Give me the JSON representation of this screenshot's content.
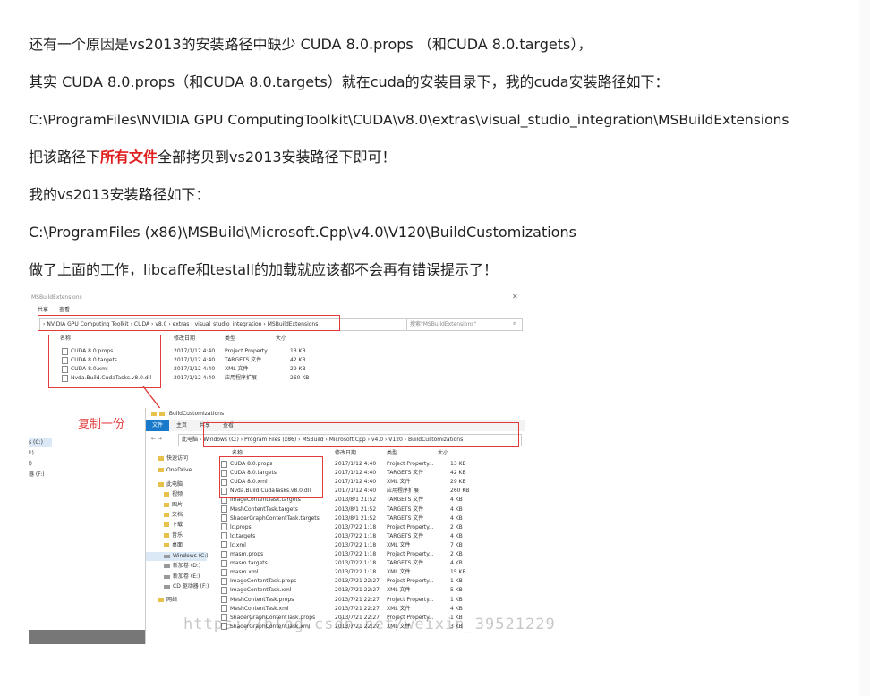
{
  "paragraphs": {
    "p1": "还有一个原因是vs2013的安装路径中缺少 CUDA 8.0.props （和CUDA 8.0.targets），",
    "p2": "其实 CUDA 8.0.props（和CUDA 8.0.targets）就在cuda的安装目录下，我的cuda安装路径如下：",
    "p3": "C:\\ProgramFiles\\NVIDIA GPU ComputingToolkit\\CUDA\\v8.0\\extras\\visual_studio_integration\\MSBuildExtensions",
    "p4_before": "把该路径下",
    "p4_highlight": "所有文件",
    "p4_after": "全部拷贝到vs2013安装路径下即可！",
    "p5": "我的vs2013安装路径如下：",
    "p6": "C:\\ProgramFiles (x86)\\MSBuild\\Microsoft.Cpp\\v4.0\\V120\\BuildCustomizations",
    "p7": "做了上面的工作，libcaffe和testall的加载就应该都不会再有错误提示了！"
  },
  "screenshot": {
    "win1": {
      "title": "MSBuildExtensions",
      "ribbon": [
        "共享",
        "查看"
      ],
      "path": [
        "NVIDIA GPU Computing Toolkit",
        "CUDA",
        "v8.0",
        "extras",
        "visual_studio_integration",
        "MSBuildExtensions"
      ],
      "search_placeholder": "搜索\"MSBuildExtensions\"",
      "headers": [
        "名称",
        "修改日期",
        "类型",
        "大小"
      ],
      "files": [
        {
          "name": "CUDA 8.0.props",
          "date": "2017/1/12 4:40",
          "type": "Project Property...",
          "size": "13 KB"
        },
        {
          "name": "CUDA 8.0.targets",
          "date": "2017/1/12 4:40",
          "type": "TARGETS 文件",
          "size": "42 KB"
        },
        {
          "name": "CUDA 8.0.xml",
          "date": "2017/1/12 4:40",
          "type": "XML 文件",
          "size": "29 KB"
        },
        {
          "name": "Nvda.Build.CudaTasks.v8.0.dll",
          "date": "2017/1/12 4:40",
          "type": "应用程序扩展",
          "size": "260 KB"
        }
      ]
    },
    "annotation": "复制一份",
    "left_strip": [
      "s (C:)",
      "k)",
      "l)",
      "器 (F:)"
    ],
    "win2": {
      "title": "BuildCustomizations",
      "ribbon": [
        "文件",
        "主页",
        "共享",
        "查看"
      ],
      "path": [
        "此电脑",
        "Windows (C:)",
        "Program Files (x86)",
        "MSBuild",
        "Microsoft.Cpp",
        "v4.0",
        "V120",
        "BuildCustomizations"
      ],
      "headers": [
        "名称",
        "修改日期",
        "类型",
        "大小"
      ],
      "nav": [
        {
          "label": "快速访问"
        },
        {
          "label": "OneDrive"
        },
        {
          "label": "此电脑"
        },
        {
          "label": "视频"
        },
        {
          "label": "图片"
        },
        {
          "label": "文档"
        },
        {
          "label": "下载"
        },
        {
          "label": "音乐"
        },
        {
          "label": "桌面"
        },
        {
          "label": "Windows (C:)"
        },
        {
          "label": "新加卷 (D:)"
        },
        {
          "label": "新加卷 (E:)"
        },
        {
          "label": "CD 驱动器 (F:)"
        },
        {
          "label": "网络"
        }
      ],
      "files": [
        {
          "name": "CUDA 8.0.props",
          "date": "2017/1/12 4:40",
          "type": "Project Property...",
          "size": "13 KB"
        },
        {
          "name": "CUDA 8.0.targets",
          "date": "2017/1/12 4:40",
          "type": "TARGETS 文件",
          "size": "42 KB"
        },
        {
          "name": "CUDA 8.0.xml",
          "date": "2017/1/12 4:40",
          "type": "XML 文件",
          "size": "29 KB"
        },
        {
          "name": "Nvda.Build.CudaTasks.v8.0.dll",
          "date": "2017/1/12 4:40",
          "type": "应用程序扩展",
          "size": "260 KB"
        },
        {
          "name": "ImageContentTask.targets",
          "date": "2013/8/1 21:52",
          "type": "TARGETS 文件",
          "size": "4 KB"
        },
        {
          "name": "MeshContentTask.targets",
          "date": "2013/8/1 21:52",
          "type": "TARGETS 文件",
          "size": "4 KB"
        },
        {
          "name": "ShaderGraphContentTask.targets",
          "date": "2013/8/1 21:52",
          "type": "TARGETS 文件",
          "size": "4 KB"
        },
        {
          "name": "lc.props",
          "date": "2013/7/22 1:18",
          "type": "Project Property...",
          "size": "2 KB"
        },
        {
          "name": "lc.targets",
          "date": "2013/7/22 1:18",
          "type": "TARGETS 文件",
          "size": "4 KB"
        },
        {
          "name": "lc.xml",
          "date": "2013/7/22 1:18",
          "type": "XML 文件",
          "size": "7 KB"
        },
        {
          "name": "masm.props",
          "date": "2013/7/22 1:18",
          "type": "Project Property...",
          "size": "2 KB"
        },
        {
          "name": "masm.targets",
          "date": "2013/7/22 1:18",
          "type": "TARGETS 文件",
          "size": "4 KB"
        },
        {
          "name": "masm.xml",
          "date": "2013/7/22 1:18",
          "type": "XML 文件",
          "size": "15 KB"
        },
        {
          "name": "ImageContentTask.props",
          "date": "2013/7/21 22:27",
          "type": "Project Property...",
          "size": "1 KB"
        },
        {
          "name": "ImageContentTask.xml",
          "date": "2013/7/21 22:27",
          "type": "XML 文件",
          "size": "5 KB"
        },
        {
          "name": "MeshContentTask.props",
          "date": "2013/7/21 22:27",
          "type": "Project Property...",
          "size": "1 KB"
        },
        {
          "name": "MeshContentTask.xml",
          "date": "2013/7/21 22:27",
          "type": "XML 文件",
          "size": "4 KB"
        },
        {
          "name": "ShaderGraphContentTask.props",
          "date": "2013/7/21 22:27",
          "type": "Project Property...",
          "size": "1 KB"
        },
        {
          "name": "ShaderGraphContentTask.xml",
          "date": "2013/7/21 22:27",
          "type": "XML 文件",
          "size": "3 KB"
        }
      ]
    },
    "watermark": "https://blog.csdn.net/weixin_39521229"
  },
  "colors": {
    "highlight": "#e02020",
    "annotation_box": "#e23b3b",
    "file_tab": "#1979ca"
  }
}
